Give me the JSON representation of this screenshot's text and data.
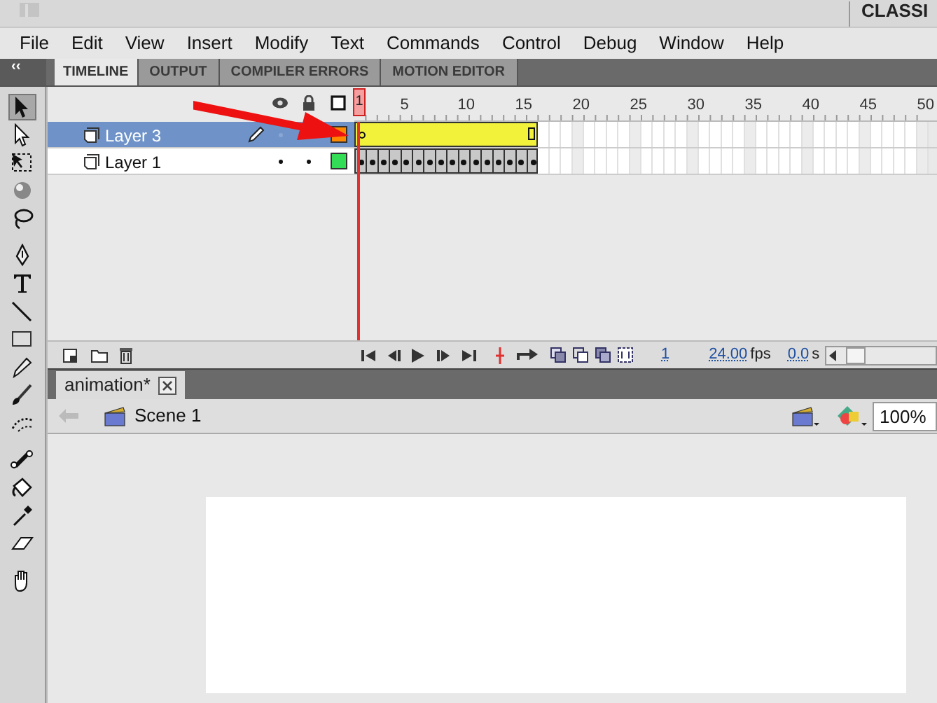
{
  "title_bar": {
    "workspace": "CLASSI"
  },
  "menu": [
    "File",
    "Edit",
    "View",
    "Insert",
    "Modify",
    "Text",
    "Commands",
    "Control",
    "Debug",
    "Window",
    "Help"
  ],
  "panel_collapse": "‹‹",
  "panel_tabs": [
    {
      "label": "TIMELINE",
      "selected": true
    },
    {
      "label": "OUTPUT",
      "selected": false
    },
    {
      "label": "COMPILER ERRORS",
      "selected": false
    },
    {
      "label": "MOTION EDITOR",
      "selected": false
    }
  ],
  "ruler": {
    "playhead": "1",
    "labels": [
      "5",
      "10",
      "15",
      "20",
      "25",
      "30",
      "35",
      "40",
      "45",
      "50"
    ]
  },
  "layers": [
    {
      "name": "Layer 3",
      "selected": true,
      "kind": "tween",
      "color": "#ff8800",
      "level": 0.32
    },
    {
      "name": "Layer 1",
      "selected": false,
      "kind": "keyframes",
      "color": "#33dd55",
      "level": 0.32
    }
  ],
  "playback": {
    "frame": "1",
    "fps": "24.00",
    "fps_unit": "fps",
    "time": "0.0",
    "time_unit": "s"
  },
  "document_tab": {
    "label": "animation*"
  },
  "edit_bar": {
    "scene": "Scene 1",
    "zoom": "100%"
  }
}
